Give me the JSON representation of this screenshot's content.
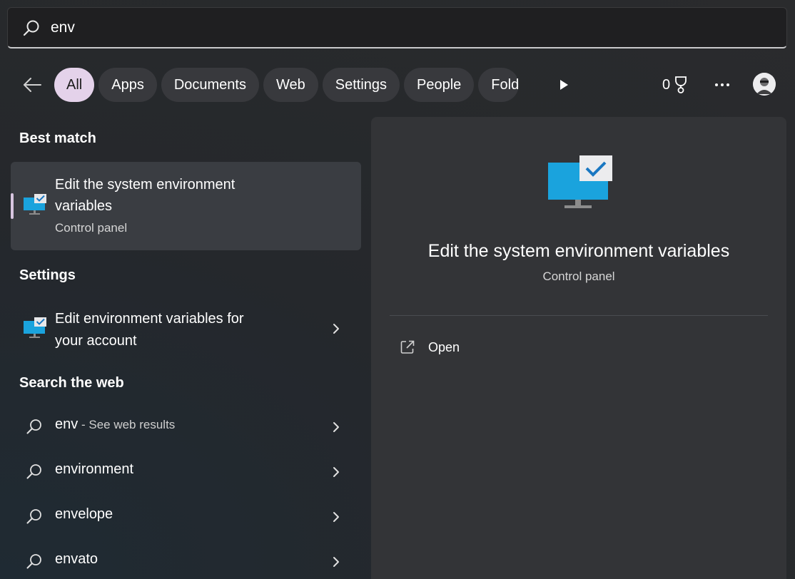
{
  "search": {
    "query": "env"
  },
  "filters": {
    "chips": [
      "All",
      "Apps",
      "Documents",
      "Web",
      "Settings",
      "People",
      "Fold"
    ],
    "active": "All"
  },
  "header": {
    "points": "0"
  },
  "best_match": {
    "heading": "Best match",
    "title_line1": "Edit the system environment",
    "title_line2": "variables",
    "subtitle": "Control panel"
  },
  "settings": {
    "heading": "Settings",
    "title_line1": "Edit environment variables for",
    "title_line2": "your account"
  },
  "web": {
    "heading": "Search the web",
    "items": [
      {
        "term": "env",
        "hint": " - See web results"
      },
      {
        "term": "environment",
        "hint": ""
      },
      {
        "term": "envelope",
        "hint": ""
      },
      {
        "term": "envato",
        "hint": ""
      }
    ]
  },
  "preview": {
    "title": "Edit the system environment variables",
    "subtitle": "Control panel",
    "open_label": "Open"
  },
  "colors": {
    "accent_chip": "#e4d2ea",
    "monitor_blue": "#1aa3dd",
    "check_blue": "#1a78c2"
  }
}
